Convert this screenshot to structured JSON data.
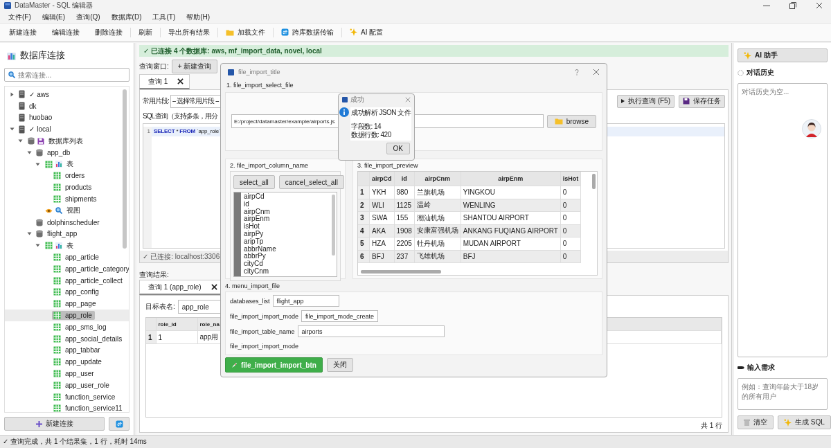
{
  "window": {
    "title": "DataMaster - SQL 编辑器"
  },
  "menu": [
    "文件(F)",
    "编辑(E)",
    "查询(Q)",
    "数据库(D)",
    "工具(T)",
    "帮助(H)"
  ],
  "toolbar": [
    {
      "label": "新建连接",
      "kind": "text"
    },
    {
      "label": "编辑连接",
      "kind": "text"
    },
    {
      "label": "删除连接",
      "kind": "text"
    },
    {
      "label": "刷新",
      "kind": "text"
    },
    {
      "label": "导出所有结果",
      "kind": "text"
    },
    {
      "label": "加载文件",
      "kind": "folder"
    },
    {
      "label": "跨库数据传输",
      "kind": "transfer"
    },
    {
      "label": "AI 配置",
      "kind": "sparkle"
    }
  ],
  "sidebar": {
    "title": "数据库连接",
    "search": {
      "placeholder": "搜索连接..."
    },
    "tree": [
      {
        "label": "✓ aws",
        "kind": "server",
        "expanded": false,
        "selected": false
      },
      {
        "label": "dk",
        "kind": "server",
        "selected": false
      },
      {
        "label": "huobao",
        "kind": "server",
        "selected": false
      },
      {
        "label": "✓ local",
        "kind": "server",
        "expanded": true,
        "selected": false,
        "children": [
          {
            "label": "数据库列表",
            "kind": "dblist",
            "expanded": true,
            "selected": false,
            "children": [
              {
                "label": "app_db",
                "kind": "database",
                "expanded": true,
                "selected": false,
                "children": [
                  {
                    "label": "表",
                    "kind": "tables",
                    "expanded": true,
                    "selected": false,
                    "children": [
                      {
                        "label": "orders",
                        "kind": "table",
                        "selected": false
                      },
                      {
                        "label": "products",
                        "kind": "table",
                        "selected": false
                      },
                      {
                        "label": "shipments",
                        "kind": "table",
                        "selected": false
                      }
                    ]
                  },
                  {
                    "label": "视图",
                    "kind": "views",
                    "selected": false
                  }
                ]
              },
              {
                "label": "dolphinscheduler",
                "kind": "database",
                "selected": false
              },
              {
                "label": "flight_app",
                "kind": "database",
                "expanded": true,
                "selected": false,
                "children": [
                  {
                    "label": "表",
                    "kind": "tables",
                    "expanded": true,
                    "selected": false,
                    "children": [
                      {
                        "label": "app_article",
                        "kind": "table",
                        "selected": false
                      },
                      {
                        "label": "app_article_category",
                        "kind": "table",
                        "selected": false
                      },
                      {
                        "label": "app_article_collect",
                        "kind": "table",
                        "selected": false
                      },
                      {
                        "label": "app_config",
                        "kind": "table",
                        "selected": false
                      },
                      {
                        "label": "app_page",
                        "kind": "table",
                        "selected": false
                      },
                      {
                        "label": "app_role",
                        "kind": "table",
                        "selected": true
                      },
                      {
                        "label": "app_sms_log",
                        "kind": "table",
                        "selected": false
                      },
                      {
                        "label": "app_social_details",
                        "kind": "table",
                        "selected": false
                      },
                      {
                        "label": "app_tabbar",
                        "kind": "table",
                        "selected": false
                      },
                      {
                        "label": "app_update",
                        "kind": "table",
                        "selected": false
                      },
                      {
                        "label": "app_user",
                        "kind": "table",
                        "selected": false
                      },
                      {
                        "label": "app_user_role",
                        "kind": "table",
                        "selected": false
                      },
                      {
                        "label": "function_service",
                        "kind": "table",
                        "selected": false
                      },
                      {
                        "label": "function_service11",
                        "kind": "table",
                        "selected": false
                      }
                    ]
                  }
                ]
              }
            ]
          }
        ]
      }
    ],
    "buttons": [
      {
        "label": "新建连接",
        "kind": "add"
      },
      {
        "kind": "refresh"
      }
    ]
  },
  "status_banner": "✓ 已连接 4 个数据库: aws, mf_import_data, novel, local",
  "query_window": {
    "label": "查询窗口:",
    "button": "+ 新建查询"
  },
  "query_tabs": [
    {
      "label": "查询 1",
      "selected": true
    }
  ],
  "snippets": {
    "label": "常用片段:",
    "value": "-- 选择常用片段 --"
  },
  "actions": [
    {
      "label": "执行查询 (F5)",
      "kind": "run"
    },
    {
      "label": "保存任务",
      "kind": "save"
    }
  ],
  "sql_label": "SQL 查询（支持多条，用分",
  "editor": {
    "lines": [
      {
        "number": "1",
        "tokens": [
          {
            "kind": "keyword",
            "text": "SELECT"
          },
          {
            "kind": "plain",
            "text": " * "
          },
          {
            "kind": "keyword",
            "text": "FROM"
          },
          {
            "kind": "plain",
            "text": " `app_role`"
          }
        ]
      }
    ]
  },
  "connection_status": "✓ 已连接: localhost:3306",
  "results_label": "查询结果:",
  "result_tabs": [
    {
      "label": "查询 1 (app_role)",
      "selected": true
    }
  ],
  "target_table": {
    "label": "目标表名:",
    "value": "app_role"
  },
  "result_table": {
    "columns": [
      "role_id",
      "role_na"
    ],
    "rows": [
      {
        "number": "1",
        "cells": [
          "1",
          "app用"
        ]
      }
    ]
  },
  "row_count": "共 1 行",
  "assistant": {
    "title": "AI 助手",
    "history_label": "对话历史",
    "history_placeholder": "对话历史为空...",
    "input_label": "输入需求",
    "input_placeholder": "例如：查询年龄大于18岁的所有用户",
    "buttons": [
      {
        "label": "清空",
        "kind": "clear"
      },
      {
        "label": "生成 SQL",
        "kind": "generate"
      }
    ]
  },
  "status_bar": "✓ 查询完成，共 1 个结果集，1 行，耗时 14ms",
  "import_dialog": {
    "title": "file_import_title",
    "select_file": {
      "heading": "1. file_import_select_file",
      "path": "E:/project/datamaster/example/airports.js",
      "browse": "browse"
    },
    "columns_section": {
      "heading": "2. file_import_column_name",
      "buttons": [
        "select_all",
        "cancel_select_all"
      ],
      "items": [
        "airpCd",
        "id",
        "airpCnm",
        "airpEnm",
        "isHot",
        "airpPy",
        "aripTp",
        "abbrName",
        "abbrPy",
        "cityCd",
        "cityCnm"
      ]
    },
    "preview": {
      "heading": "3. file_import_preview",
      "columns": [
        "airpCd",
        "id",
        "airpCnm",
        "airpEnm",
        "isHot"
      ],
      "rows": [
        {
          "number": "1",
          "cells": [
            "YKH",
            "980",
            "兰旗机场",
            "YINGKOU",
            "0"
          ]
        },
        {
          "number": "2",
          "cells": [
            "WLI",
            "1125",
            "温岭",
            "WENLING",
            "0"
          ]
        },
        {
          "number": "3",
          "cells": [
            "SWA",
            "155",
            "潮汕机场",
            "SHANTOU AIRPORT",
            "0"
          ]
        },
        {
          "number": "4",
          "cells": [
            "AKA",
            "1908",
            "安康富强机场",
            "ANKANG FUQIANG AIRPORT",
            "0"
          ]
        },
        {
          "number": "5",
          "cells": [
            "HZA",
            "2205",
            "牡丹机场",
            "MUDAN AIRPORT",
            "0"
          ]
        },
        {
          "number": "6",
          "cells": [
            "BFJ",
            "237",
            "飞雄机场",
            "BFJ",
            "0"
          ]
        }
      ]
    },
    "import_settings": {
      "heading": "4. menu_import_file",
      "fields": [
        {
          "label": "databases_list",
          "value": "flight_app",
          "kind": "combo"
        },
        {
          "label": "file_import_import_mode",
          "value": "file_import_mode_create",
          "kind": "combo"
        },
        {
          "label": "file_import_table_name",
          "value": "airports",
          "kind": "text"
        },
        {
          "label": "file_import_import_mode",
          "kind": "label"
        }
      ]
    },
    "footer": [
      {
        "label": "file_import_import_btn",
        "kind": "primary"
      },
      {
        "label": "关闭",
        "kind": "secondary"
      }
    ]
  },
  "message_box": {
    "title": "成功",
    "message": "成功解析 JSON 文件",
    "details": [
      "字段数: 14",
      "数据行数: 420"
    ],
    "button": "OK"
  }
}
